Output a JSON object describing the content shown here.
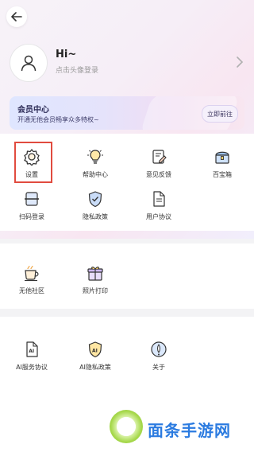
{
  "profile": {
    "greeting": "Hi~",
    "login_tip": "点击头像登录"
  },
  "vip": {
    "title": "会员中心",
    "subtitle": "开通无他会员畅享众多特权~",
    "button_label": "立即前往"
  },
  "grid_section_1": [
    {
      "label": "设置",
      "icon": "gear-icon"
    },
    {
      "label": "帮助中心",
      "icon": "lightbulb-icon"
    },
    {
      "label": "意见反馈",
      "icon": "feedback-icon"
    },
    {
      "label": "百宝箱",
      "icon": "treasure-box-icon"
    },
    {
      "label": "扫码登录",
      "icon": "scan-icon"
    },
    {
      "label": "隐私政策",
      "icon": "shield-check-icon"
    },
    {
      "label": "用户协议",
      "icon": "document-icon"
    }
  ],
  "grid_section_2": [
    {
      "label": "无他社区",
      "icon": "cup-icon"
    },
    {
      "label": "照片打印",
      "icon": "gift-icon"
    }
  ],
  "grid_section_3": [
    {
      "label": "AI服务协议",
      "icon": "ai-document-icon"
    },
    {
      "label": "AI隐私政策",
      "icon": "ai-shield-icon"
    },
    {
      "label": "关于",
      "icon": "about-icon"
    }
  ],
  "watermark": {
    "text": "面条手游网"
  },
  "colors": {
    "accent": "#e14b3f",
    "watermark_blue": "#2b7be0",
    "watermark_green": "#8cc83a"
  }
}
